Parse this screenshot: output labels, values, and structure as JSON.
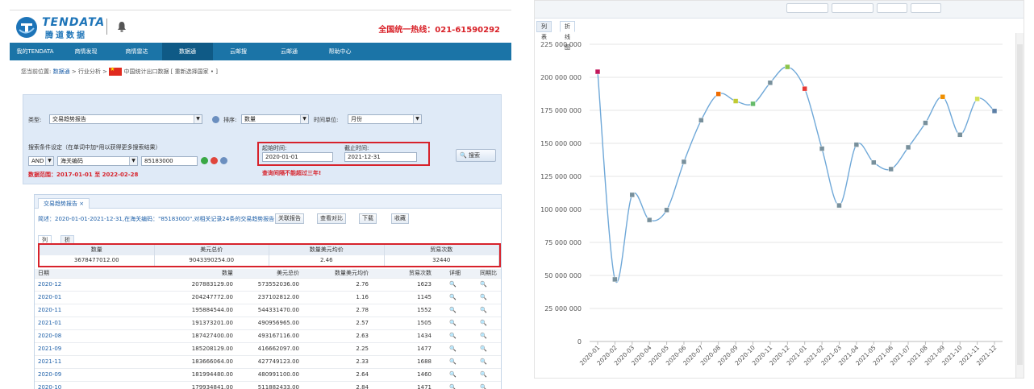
{
  "header": {
    "logo_en": "TENDATA",
    "logo_cn": "腾道数据",
    "hotline": "全国统一热线：021-61590292"
  },
  "nav": [
    "我的TENDATA",
    "商情发现",
    "商情雷达",
    "数据通",
    "云邮搜",
    "云邮通",
    "帮助中心"
  ],
  "breadcrumb": {
    "prefix": "您当前位置:",
    "link": "数据通",
    "middle": " > 行业分析 > ",
    "suffix": "中国统计出口数据 [ 重新选择国家 • ]"
  },
  "form": {
    "type_label": "类型:",
    "type_value": "交易趋势报告",
    "sort_label": "排序:",
    "sort_value": "数量",
    "unit_label": "时间单位:",
    "unit_value": "月份",
    "search_label": "搜索条件设定（在单词中加*用以获得更多搜索结果）",
    "logic_value": "AND",
    "field_value": "海关编码",
    "code_value": "85183000",
    "start_label": "起始时间:",
    "start_value": "2020-01-01",
    "end_label": "截止时间:",
    "end_value": "2021-12-31",
    "range_warning": "查询间隔不能超过三年!",
    "data_range": "数据范围：2017-01-01 至 2022-02-28",
    "search_button": "搜索"
  },
  "report": {
    "tab": "交易趋势报告",
    "description": "简述：2020-01-01-2021-12-31,在海关编码：\"85183000\",对相关记录24条的交易趋势报告",
    "buttons": [
      "关联报告",
      "查看对比",
      "下载",
      "收藏"
    ],
    "subtabs": [
      "列表",
      "折线图"
    ],
    "summary_headers": [
      "数量",
      "美元总价",
      "数量美元均价",
      "贸易次数"
    ],
    "summary_values": [
      "3678477012.00",
      "9043390254.00",
      "2.46",
      "32440"
    ],
    "columns": [
      "日期",
      "数量",
      "美元总价",
      "数量美元均价",
      "贸易次数",
      "详细",
      "同期比"
    ],
    "rows": [
      [
        "2020-12",
        "207883129.00",
        "573552036.00",
        "2.76",
        "1623"
      ],
      [
        "2020-01",
        "204247772.00",
        "237102812.00",
        "1.16",
        "1145"
      ],
      [
        "2020-11",
        "195884544.00",
        "544331470.00",
        "2.78",
        "1552"
      ],
      [
        "2021-01",
        "191373201.00",
        "490956965.00",
        "2.57",
        "1505"
      ],
      [
        "2020-08",
        "187427400.00",
        "493167116.00",
        "2.63",
        "1434"
      ],
      [
        "2021-09",
        "185208129.00",
        "416662097.00",
        "2.25",
        "1477"
      ],
      [
        "2021-11",
        "183666064.00",
        "427749123.00",
        "2.33",
        "1688"
      ],
      [
        "2020-09",
        "181994480.00",
        "480991100.00",
        "2.64",
        "1460"
      ],
      [
        "2020-10",
        "179934841.00",
        "511882433.00",
        "2.84",
        "1471"
      ]
    ]
  },
  "chart_tabs": [
    "列表",
    "折线图"
  ],
  "chart_data": {
    "type": "line",
    "categories": [
      "2020-01",
      "2020-02",
      "2020-03",
      "2020-04",
      "2020-05",
      "2020-06",
      "2020-07",
      "2020-08",
      "2020-09",
      "2020-10",
      "2020-11",
      "2020-12",
      "2021-01",
      "2021-02",
      "2021-03",
      "2021-04",
      "2021-05",
      "2021-06",
      "2021-07",
      "2021-08",
      "2021-09",
      "2021-10",
      "2021-11",
      "2021-12"
    ],
    "values": [
      204247772,
      47000000,
      111000000,
      92000000,
      99500000,
      136000000,
      167500000,
      187427400,
      181994480,
      179934841,
      195884544,
      207883129,
      191373201,
      146000000,
      103000000,
      149000000,
      135500000,
      130500000,
      147000000,
      165500000,
      185208129,
      156500000,
      183666064,
      174500000
    ],
    "ylim": [
      0,
      225000000
    ],
    "yticks": [
      "0",
      "25 000 000",
      "50 000 000",
      "75 000 000",
      "100 000 000",
      "125 000 000",
      "150 000 000",
      "175 000 000",
      "200 000 000",
      "225 000 000"
    ],
    "marker_colors": [
      "#c2185b",
      "#78909c",
      "#78909c",
      "#78909c",
      "#78909c",
      "#78909c",
      "#78909c",
      "#ef6c00",
      "#c0ca33",
      "#66bb6a",
      "#78909c",
      "#8bc34a",
      "#e53935",
      "#78909c",
      "#78909c",
      "#78909c",
      "#78909c",
      "#78909c",
      "#78909c",
      "#78909c",
      "#ef8f00",
      "#78909c",
      "#d4e157",
      "#5c7fa6"
    ],
    "line_color": "#6fa8d8",
    "grid": true
  }
}
